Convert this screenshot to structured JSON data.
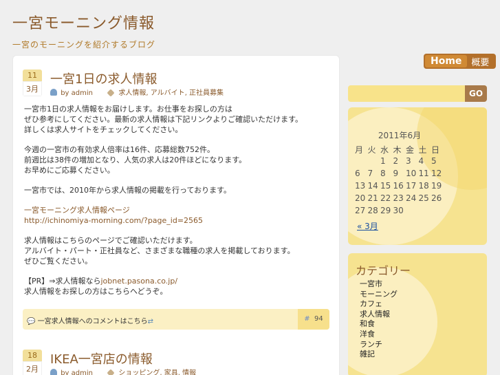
{
  "site": {
    "title": "一宮モーニング情報",
    "description": "一宮のモーニングを紹介するブログ"
  },
  "nav": {
    "home": "Home",
    "item": "概要"
  },
  "search": {
    "placeholder": "",
    "go": "GO"
  },
  "posts": [
    {
      "day": "11",
      "month": "3月",
      "title": "一宮1日の求人情報",
      "author": "by admin",
      "tags": [
        "求人情報",
        "アルバイト",
        "正社員募集"
      ],
      "paragraphs": [
        [
          "一宮市1日の求人情報をお届けします。お仕事をお探しの方は",
          "ぜひ参考にしてください。最新の求人情報は下記リンクよりご確認いただけます。",
          "詳しくは求人サイトをチェックしてください。"
        ],
        [
          "今週の一宮市の有効求人倍率は16件、応募総数752件。",
          "前週比は38件の増加となり、人気の求人は20件ほどになります。",
          "お早めにご応募ください。"
        ],
        [
          "一宮市では、2010年から求人情報の掲載を行っております。"
        ]
      ],
      "link_label": "一宮モーニング求人情報ページ",
      "link_url": "http://ichinomiya-morning.com/?page_id=2565",
      "paragraphs2": [
        [
          "求人情報はこちらのページでご確認いただけます。",
          "アルバイト・パート・正社員など、さまざまな職種の求人を掲載しております。",
          "ぜひご覧ください。"
        ]
      ],
      "pr_prefix": "【PR】⇒求人情報なら",
      "pr_link": "jobnet.pasona.co.jp/",
      "pr_after": "求人情報をお探しの方はこちらへどうぞ。",
      "comment_text": "一宮求人情報へのコメントはこちら",
      "comment_count": "94"
    },
    {
      "day": "18",
      "month": "2月",
      "title": "IKEA一宮店の情報",
      "author": "by admin",
      "tags": [
        "ショッピング",
        "家具",
        "情報"
      ]
    }
  ],
  "calendar": {
    "caption": "2011年6月",
    "weekdays": [
      "月",
      "火",
      "水",
      "木",
      "金",
      "土",
      "日"
    ],
    "weeks": [
      [
        "",
        "",
        "",
        "1",
        "2",
        "3",
        "4",
        "5"
      ],
      [
        "6",
        "7",
        "8",
        "9",
        "10",
        "11",
        "12"
      ],
      [
        "13",
        "14",
        "15",
        "16",
        "17",
        "18",
        "19"
      ],
      [
        "20",
        "21",
        "22",
        "23",
        "24",
        "25",
        "26"
      ],
      [
        "27",
        "28",
        "29",
        "30",
        "",
        "",
        ""
      ]
    ],
    "prev": "« 3月"
  },
  "categories": {
    "title": "カテゴリー",
    "items": [
      "一宮市",
      "モーニング",
      "カフェ",
      "求人情報",
      "和食",
      "洋食",
      "ランチ",
      "雑記"
    ]
  }
}
